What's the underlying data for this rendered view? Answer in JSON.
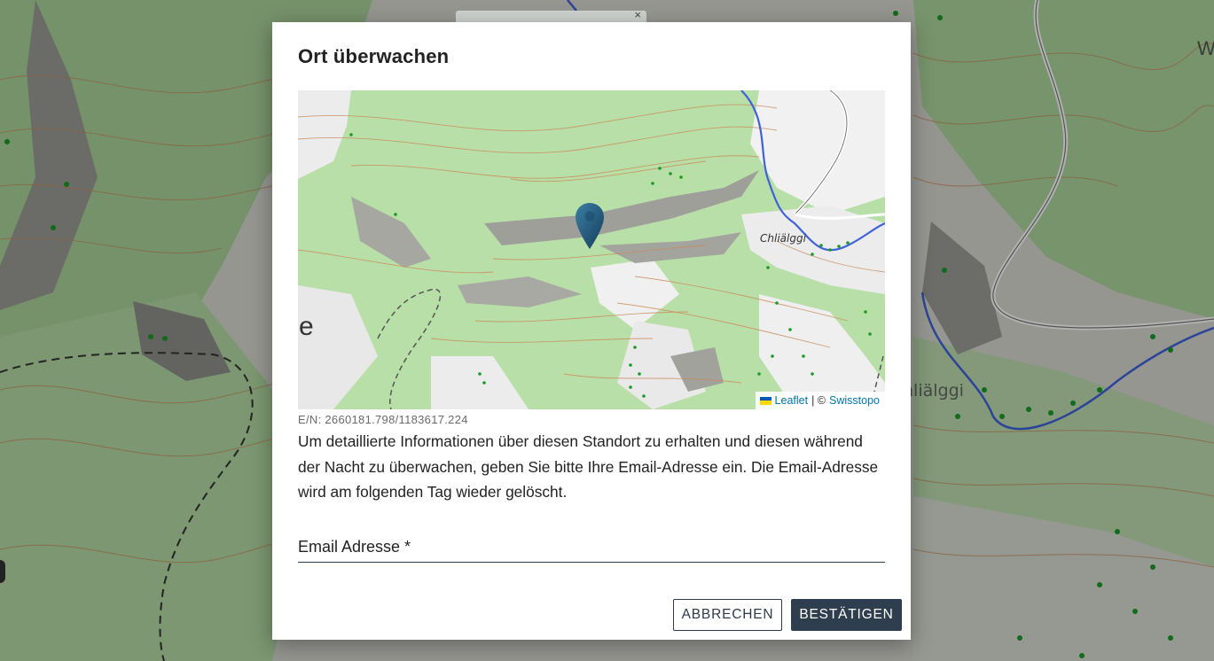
{
  "background_map": {
    "place_label": "hliälggi",
    "edge_letter": "W",
    "top_control_close": "×"
  },
  "dialog": {
    "title": "Ort überwachen",
    "map": {
      "place_label": "Chliälggi",
      "edge_letter": "e",
      "attribution": {
        "leaflet": "Leaflet",
        "separator": "| ©",
        "provider": "Swisstopo"
      }
    },
    "coordinates": "E/N: 2660181.798/1183617.224",
    "description": "Um detaillierte Informationen über diesen Standort zu erhalten und diesen während der Nacht zu überwachen, geben Sie bitte Ihre Email-Adresse ein. Die Email-Adresse wird am folgenden Tag wieder gelöscht.",
    "email": {
      "label": "Email Adresse *",
      "value": ""
    },
    "buttons": {
      "cancel": "ABBRECHEN",
      "confirm": "BESTÄTIGEN"
    }
  },
  "colors": {
    "primary": "#2e3e4e",
    "forest": "#b5dba3",
    "river": "#3f62d8",
    "contour": "#c98a5a",
    "link": "#0078a8"
  },
  "icons": {
    "marker": "map-marker-icon",
    "flag": "ukraine-flag-icon"
  }
}
